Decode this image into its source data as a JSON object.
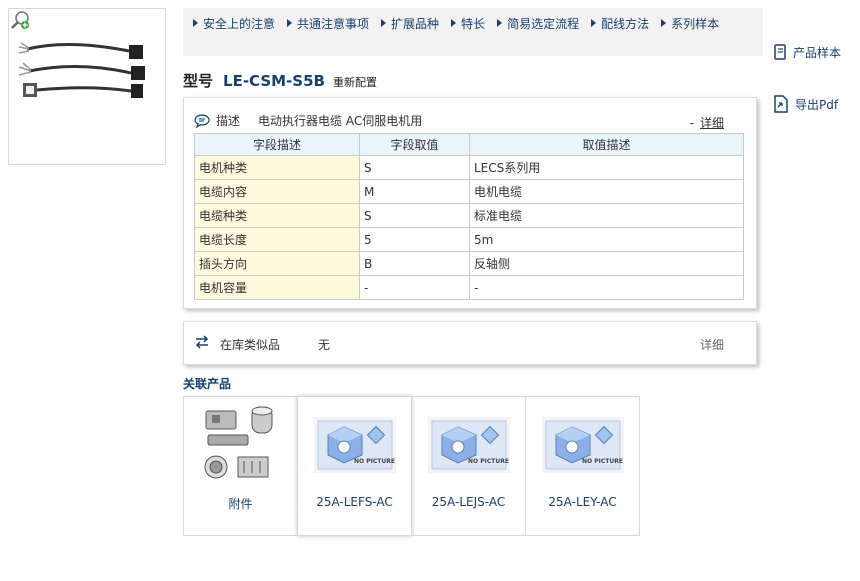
{
  "nav": {
    "links": [
      "安全上的注意",
      "共通注意事项",
      "扩展品种",
      "特长",
      "简易选定流程",
      "配线方法",
      "系列样本"
    ]
  },
  "side_links": {
    "sample": "产品样本",
    "pdf": "导出Pdf"
  },
  "model": {
    "label": "型号",
    "code": "LE-CSM-S5B",
    "reset": "重新配置"
  },
  "description": {
    "label": "描述",
    "text": "电动执行器电缆 AC伺服电机用",
    "dash": "-",
    "detail": "详细"
  },
  "spec_table": {
    "headers": [
      "字段描述",
      "字段取值",
      "取值描述"
    ],
    "rows": [
      [
        "电机种类",
        "S",
        "LECS系列用"
      ],
      [
        "电缆内容",
        "M",
        "电机电缆"
      ],
      [
        "电缆种类",
        "S",
        "标准电缆"
      ],
      [
        "电缆长度",
        "5",
        "5m"
      ],
      [
        "插头方向",
        "B",
        "反轴侧"
      ],
      [
        "电机容量",
        "-",
        "-"
      ]
    ]
  },
  "similar": {
    "label": "在库类似品",
    "value": "无",
    "detail": "详细"
  },
  "related": {
    "title": "关联产品",
    "items": [
      {
        "name": "附件",
        "thumb": "accessories-photo"
      },
      {
        "name": "25A-LEFS-AC",
        "thumb": "no-picture",
        "placeholder": "NO PICTURE"
      },
      {
        "name": "25A-LEJS-AC",
        "thumb": "no-picture",
        "placeholder": "NO PICTURE"
      },
      {
        "name": "25A-LEY-AC",
        "thumb": "no-picture",
        "placeholder": "NO PICTURE"
      }
    ]
  },
  "colors": {
    "link": "#1a3e6e",
    "nav_bg": "#f2f2f2",
    "table_header_bg": "#eaf5fb",
    "field_cell_bg": "#fdf9dc"
  }
}
